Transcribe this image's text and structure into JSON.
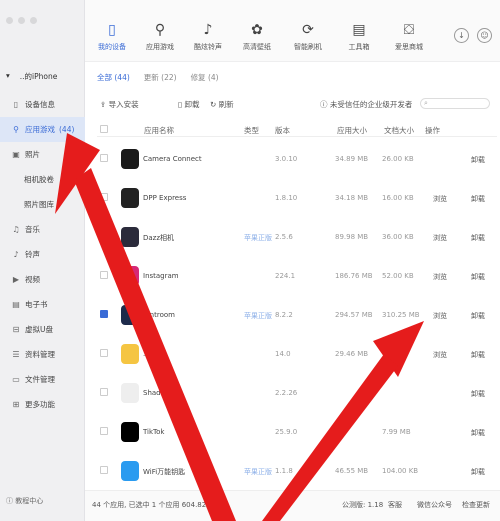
{
  "sidebar": {
    "device": "..的iPhone",
    "items": [
      {
        "label": "设备信息",
        "icon": "phone-icon",
        "sub": false
      },
      {
        "label": "应用游戏",
        "count": "(44)",
        "icon": "app-icon",
        "sub": false,
        "active": true
      },
      {
        "label": "照片",
        "icon": "photo-icon",
        "sub": false
      },
      {
        "label": "相机胶卷",
        "sub": true
      },
      {
        "label": "照片图库",
        "sub": true
      },
      {
        "label": "音乐",
        "icon": "music-icon",
        "sub": false
      },
      {
        "label": "铃声",
        "icon": "bell-icon",
        "sub": false
      },
      {
        "label": "视频",
        "icon": "video-icon",
        "sub": false
      },
      {
        "label": "电子书",
        "icon": "book-icon",
        "sub": false
      },
      {
        "label": "虚拟U盘",
        "icon": "usb-icon",
        "sub": false
      },
      {
        "label": "资料管理",
        "icon": "contacts-icon",
        "sub": false
      },
      {
        "label": "文件管理",
        "icon": "folder-icon",
        "sub": false
      },
      {
        "label": "更多功能",
        "icon": "grid-icon",
        "sub": false
      }
    ],
    "help": "教程中心"
  },
  "topnav": [
    {
      "label": "我的设备",
      "icon": "device-icon",
      "active": true
    },
    {
      "label": "应用游戏",
      "icon": "appstore-icon"
    },
    {
      "label": "酷炫铃声",
      "icon": "music-note-icon"
    },
    {
      "label": "高清壁纸",
      "icon": "flower-icon"
    },
    {
      "label": "智能刷机",
      "icon": "flash-icon"
    },
    {
      "label": "工具箱",
      "icon": "toolbox-icon"
    },
    {
      "label": "爱思商城",
      "icon": "shop-icon"
    }
  ],
  "tabs": [
    "全部 (44)",
    "更新 (22)",
    "修复 (4)"
  ],
  "toolbar": {
    "install": "导入安装",
    "uninstall": "卸载",
    "refresh": "刷新",
    "trust": "未受信任的企业级开发者"
  },
  "columns": [
    "应用名称",
    "类型",
    "版本",
    "应用大小",
    "文档大小",
    "操作"
  ],
  "apps": [
    {
      "name": "Camera Connect",
      "type": "",
      "version": "3.0.10",
      "size": "34.89 MB",
      "doc": "26.00 KB",
      "action": "",
      "uninstall": "卸载",
      "color": "#1a1a1a",
      "checked": false
    },
    {
      "name": "DPP Express",
      "type": "",
      "version": "1.8.10",
      "size": "34.18 MB",
      "doc": "16.00 KB",
      "action": "浏览",
      "uninstall": "卸载",
      "color": "#222222",
      "checked": false
    },
    {
      "name": "Dazz相机",
      "type": "苹果正版",
      "version": "2.5.6",
      "size": "89.98 MB",
      "doc": "36.00 KB",
      "action": "浏览",
      "uninstall": "卸载",
      "color": "#2b2b3b",
      "checked": false
    },
    {
      "name": "Instagram",
      "type": "",
      "version": "224.1",
      "size": "186.76 MB",
      "doc": "52.00 KB",
      "action": "浏览",
      "uninstall": "卸载",
      "color": "#d62976",
      "checked": false
    },
    {
      "name": "...ntroom",
      "type": "苹果正版",
      "version": "8.2.2",
      "size": "294.57 MB",
      "doc": "310.25 MB",
      "action": "浏览",
      "uninstall": "卸载",
      "color": "#1d2b4b",
      "checked": true
    },
    {
      "name": "...us",
      "type": "",
      "version": "14.0",
      "size": "29.46 MB",
      "doc": "",
      "action": "浏览",
      "uninstall": "卸载",
      "color": "#f5c542",
      "checked": false
    },
    {
      "name": "Shad...",
      "type": "",
      "version": "2.2.26",
      "size": "",
      "doc": "",
      "action": "",
      "uninstall": "卸载",
      "color": "#eeeeee",
      "checked": false
    },
    {
      "name": "TikTok",
      "type": "",
      "version": "25.9.0",
      "size": "",
      "doc": "7.99 MB",
      "action": "",
      "uninstall": "卸载",
      "color": "#000000",
      "checked": false
    },
    {
      "name": "WiFi万能钥匙",
      "type": "苹果正版",
      "version": "1.1.8",
      "size": "46.55 MB",
      "doc": "104.00 KB",
      "action": "",
      "uninstall": "卸载",
      "color": "#2a9bf0",
      "checked": false
    }
  ],
  "footer": {
    "summary": "44 个应用, 已选中 1 个应用 604.82 MB,",
    "version": "公测版: 1.18",
    "service": "客服",
    "wechat": "微信公众号",
    "update": "检查更新"
  }
}
